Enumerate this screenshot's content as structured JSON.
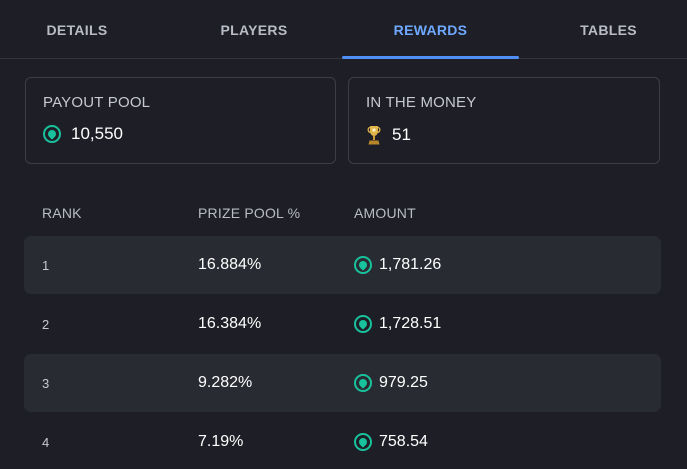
{
  "tabs": [
    {
      "label": "DETAILS",
      "active": false
    },
    {
      "label": "PLAYERS",
      "active": false
    },
    {
      "label": "REWARDS",
      "active": true
    },
    {
      "label": "TABLES",
      "active": false
    }
  ],
  "colors": {
    "background": "#1e1f26",
    "accent_tab": "#4f8ef7",
    "coin": "#18c29c",
    "row_shade": "#292b33",
    "trophy": "#e0b54a"
  },
  "stats": {
    "payout_pool": {
      "label": "PAYOUT POOL",
      "value": "10,550",
      "icon": "coin-icon"
    },
    "in_the_money": {
      "label": "IN THE MONEY",
      "value": "51",
      "icon": "trophy-icon"
    }
  },
  "table": {
    "headers": [
      "RANK",
      "PRIZE POOL %",
      "AMOUNT"
    ],
    "rows": [
      {
        "rank": "1",
        "pct": "16.884%",
        "amount": "1,781.26"
      },
      {
        "rank": "2",
        "pct": "16.384%",
        "amount": "1,728.51"
      },
      {
        "rank": "3",
        "pct": "9.282%",
        "amount": "979.25"
      },
      {
        "rank": "4",
        "pct": "7.19%",
        "amount": "758.54"
      }
    ]
  }
}
